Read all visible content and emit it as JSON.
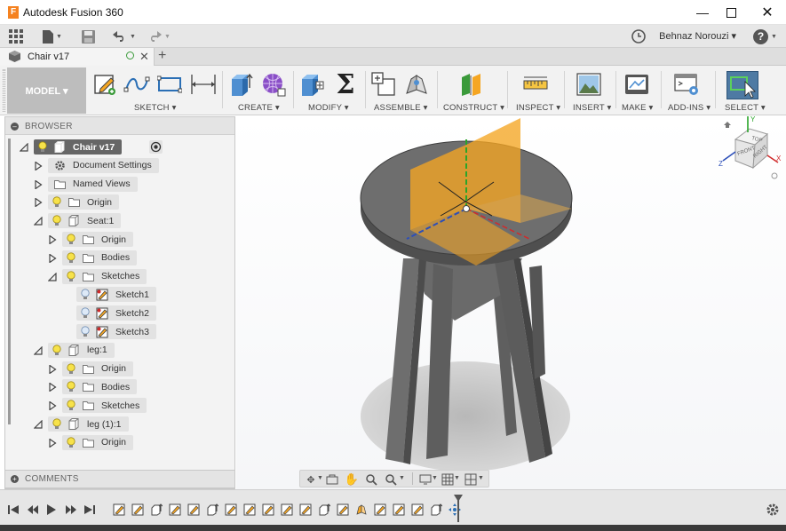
{
  "window": {
    "title": "Autodesk Fusion 360",
    "app_icon_letter": "F"
  },
  "quick_access": {
    "user_name": "Behnaz Norouzi ▾",
    "help_label": "?"
  },
  "document_tab": {
    "label": "Chair v17"
  },
  "toolbar": {
    "workspace": "MODEL ▾",
    "groups": [
      {
        "label": "SKETCH ▾"
      },
      {
        "label": "CREATE ▾"
      },
      {
        "label": "MODIFY ▾"
      },
      {
        "label": "ASSEMBLE ▾"
      },
      {
        "label": "CONSTRUCT ▾"
      },
      {
        "label": "INSPECT ▾"
      },
      {
        "label": "INSERT ▾"
      },
      {
        "label": "MAKE ▾"
      },
      {
        "label": "ADD-INS ▾"
      },
      {
        "label": "SELECT ▾"
      }
    ]
  },
  "browser": {
    "title": "BROWSER",
    "items": [
      {
        "label": "Chair v17",
        "level": 0,
        "expanded": true,
        "icon": "document-icon",
        "bulb": true,
        "active": true
      },
      {
        "label": "Document Settings",
        "level": 1,
        "expanded": false,
        "icon": "gear-icon",
        "bulb": false
      },
      {
        "label": "Named Views",
        "level": 1,
        "expanded": false,
        "icon": "folder-icon",
        "bulb": false
      },
      {
        "label": "Origin",
        "level": 1,
        "expanded": false,
        "icon": "folder-icon",
        "bulb": true
      },
      {
        "label": "Seat:1",
        "level": 1,
        "expanded": true,
        "icon": "component-icon",
        "bulb": true
      },
      {
        "label": "Origin",
        "level": 2,
        "expanded": false,
        "icon": "folder-icon",
        "bulb": true
      },
      {
        "label": "Bodies",
        "level": 2,
        "expanded": false,
        "icon": "folder-icon",
        "bulb": true
      },
      {
        "label": "Sketches",
        "level": 2,
        "expanded": true,
        "icon": "folder-icon",
        "bulb": true
      },
      {
        "label": "Sketch1",
        "level": 3,
        "expanded": null,
        "icon": "sketch-icon",
        "bulb": true
      },
      {
        "label": "Sketch2",
        "level": 3,
        "expanded": null,
        "icon": "sketch-icon",
        "bulb": true
      },
      {
        "label": "Sketch3",
        "level": 3,
        "expanded": null,
        "icon": "sketch-icon",
        "bulb": true
      },
      {
        "label": "leg:1",
        "level": 1,
        "expanded": true,
        "icon": "component-icon",
        "bulb": true
      },
      {
        "label": "Origin",
        "level": 2,
        "expanded": false,
        "icon": "folder-icon",
        "bulb": true
      },
      {
        "label": "Bodies",
        "level": 2,
        "expanded": false,
        "icon": "folder-icon",
        "bulb": true
      },
      {
        "label": "Sketches",
        "level": 2,
        "expanded": false,
        "icon": "folder-icon",
        "bulb": true
      },
      {
        "label": "leg (1):1",
        "level": 1,
        "expanded": true,
        "icon": "component-icon",
        "bulb": true
      },
      {
        "label": "Origin",
        "level": 2,
        "expanded": false,
        "icon": "folder-icon",
        "bulb": true
      }
    ]
  },
  "comments": {
    "title": "COMMENTS"
  },
  "viewcube": {
    "top": "TOP",
    "front": "FRONT",
    "right": "RIGHT",
    "axis_x": "X",
    "axis_y": "Y",
    "axis_z": "Z"
  },
  "colors": {
    "accent_orange": "#f5a623",
    "model_gray": "#6d6d6d",
    "active_node": "#666666",
    "select_blue": "#4e7aa3"
  }
}
